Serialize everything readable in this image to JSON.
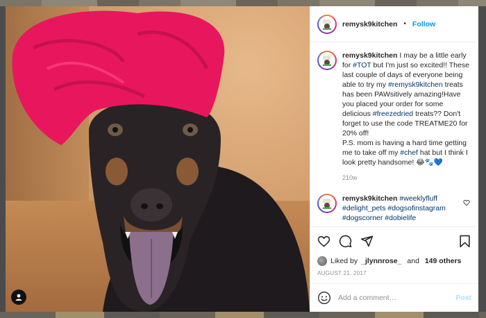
{
  "post": {
    "photo_alt_icon": "user-profile-icon"
  },
  "header": {
    "username": "remysk9kitchen",
    "separator": "•",
    "follow_label": "Follow"
  },
  "caption": {
    "username": "remysk9kitchen",
    "segments": [
      {
        "text": "I may be a little early for ",
        "tag": false
      },
      {
        "text": "#TOT",
        "tag": true
      },
      {
        "text": " but I'm just so excited!! These last couple of days of everyone being able to try my ",
        "tag": false
      },
      {
        "text": "#remysk9kitchen",
        "tag": true
      },
      {
        "text": " treats has been PAWsitively amazing!Have you placed your order for some delicious ",
        "tag": false
      },
      {
        "text": "#freezedried",
        "tag": true
      },
      {
        "text": " treats?? Don't forget to use the code TREATME20 for 20% off!",
        "tag": false
      },
      {
        "text": "\nP.S. mom is having a hard time getting me to take off my ",
        "tag": false
      },
      {
        "text": "#chef",
        "tag": true
      },
      {
        "text": " hat but I think I look pretty handsome! 😂🐾💙",
        "tag": false
      }
    ],
    "age": "210w"
  },
  "second_comment": {
    "username": "remysk9kitchen",
    "segments": [
      {
        "text": "#weeklyfluff",
        "tag": true
      },
      {
        "text": " ",
        "tag": false
      },
      {
        "text": "#delight_pets",
        "tag": true
      },
      {
        "text": " ",
        "tag": false
      },
      {
        "text": "#dogsofinstagram",
        "tag": true
      },
      {
        "text": " ",
        "tag": false
      },
      {
        "text": "#dogscorner",
        "tag": true
      },
      {
        "text": " ",
        "tag": false
      },
      {
        "text": "#dobielife",
        "tag": true
      }
    ]
  },
  "likes": {
    "prefix": "Liked by ",
    "user": "_jlynnrose_",
    "middle": " and ",
    "others": "149 others"
  },
  "date": "AUGUST 21, 2017",
  "comment_box": {
    "placeholder": "Add a comment…",
    "post_label": "Post"
  },
  "colors": {
    "link": "#00376b",
    "follow": "#0095f6",
    "hat": "#e8175d"
  }
}
